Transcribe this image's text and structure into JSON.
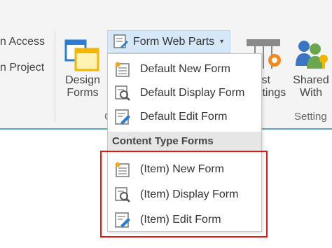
{
  "ribbon": {
    "left_items": [
      "n Access",
      "n Project"
    ],
    "design_forms": "Design\nForms",
    "design_forms_l1": "Design",
    "design_forms_l2": "Forms",
    "group_label_fragment": "C",
    "list_settings_l1": "ist",
    "list_settings_l2": "ttings",
    "shared_with_l1": "Shared",
    "shared_with_l2": "With",
    "settings_group_label": "Setting"
  },
  "form_web_parts": {
    "label": "Form Web Parts",
    "caret": "▾"
  },
  "menu": {
    "items": [
      {
        "label": "Default New Form",
        "icon": "new-form-icon"
      },
      {
        "label": "Default Display Form",
        "icon": "display-form-icon"
      },
      {
        "label": "Default Edit Form",
        "icon": "edit-form-icon"
      }
    ],
    "section_header": "Content Type Forms",
    "ct_items": [
      {
        "label": "(Item) New Form",
        "icon": "new-form-icon"
      },
      {
        "label": "(Item) Display Form",
        "icon": "display-form-icon"
      },
      {
        "label": "(Item) Edit Form",
        "icon": "edit-form-icon"
      }
    ]
  },
  "colors": {
    "accent_blue": "#2b7cd3",
    "highlight_red": "#ee1111",
    "ribbon_bg": "#f4f4f4"
  }
}
